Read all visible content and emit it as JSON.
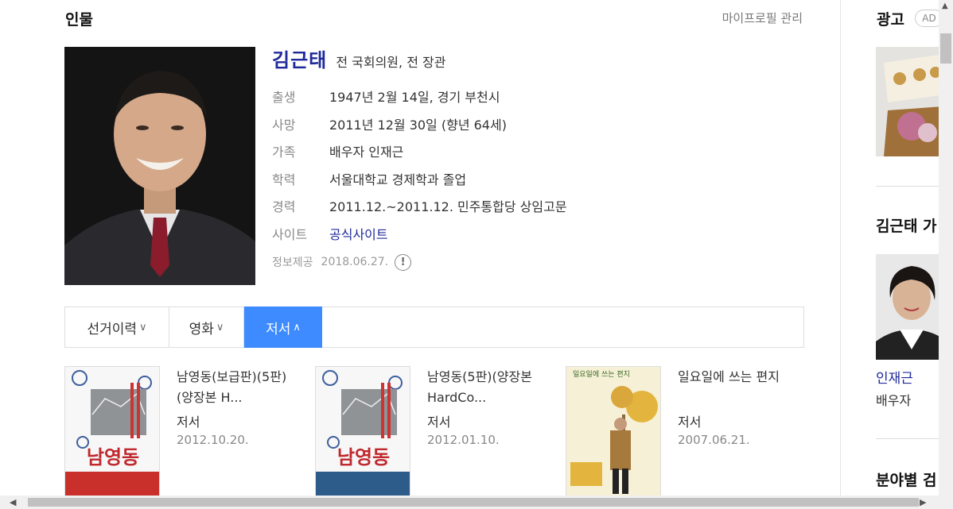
{
  "section": {
    "title": "인물",
    "manage_link": "마이프로필 관리"
  },
  "profile": {
    "name": "김근태",
    "description": "전 국회의원, 전 장관",
    "info": [
      {
        "key": "출생",
        "value": "1947년 2월 14일, 경기 부천시"
      },
      {
        "key": "사망",
        "value": "2011년 12월 30일 (향년 64세)"
      },
      {
        "key": "가족",
        "value": "배우자 인재근"
      },
      {
        "key": "학력",
        "value": "서울대학교 경제학과 졸업"
      },
      {
        "key": "경력",
        "value": "2011.12.~2011.12. 민주통합당 상임고문"
      },
      {
        "key": "사이트",
        "value": "공식사이트"
      }
    ],
    "source_label": "정보제공",
    "source_date": "2018.06.27.",
    "source_icon": "!"
  },
  "tabs": [
    {
      "label": "선거이력",
      "chevron": "∨",
      "active": false
    },
    {
      "label": "영화",
      "chevron": "∨",
      "active": false
    },
    {
      "label": "저서",
      "chevron": "∧",
      "active": true
    }
  ],
  "books": [
    {
      "title": "남영동(보급판)(5판)(양장본 H...",
      "type": "저서",
      "date": "2012.10.20.",
      "cover_text": "남영동"
    },
    {
      "title": "남영동(5판)(양장본 HardCo...",
      "type": "저서",
      "date": "2012.01.10.",
      "cover_text": "남영동"
    },
    {
      "title": "일요일에 쓰는 편지",
      "type": "저서",
      "date": "2007.06.21.",
      "cover_text": "일요일에 쓰는 편지"
    }
  ],
  "sidebar": {
    "ad_title": "광고",
    "ad_badge": "AD",
    "related_title": "김근태 가",
    "related_person": {
      "name": "인재근",
      "role": "배우자"
    },
    "field_title": "분야별 검"
  },
  "colors": {
    "accent": "#3d8bff",
    "name": "#1f2a9a"
  }
}
